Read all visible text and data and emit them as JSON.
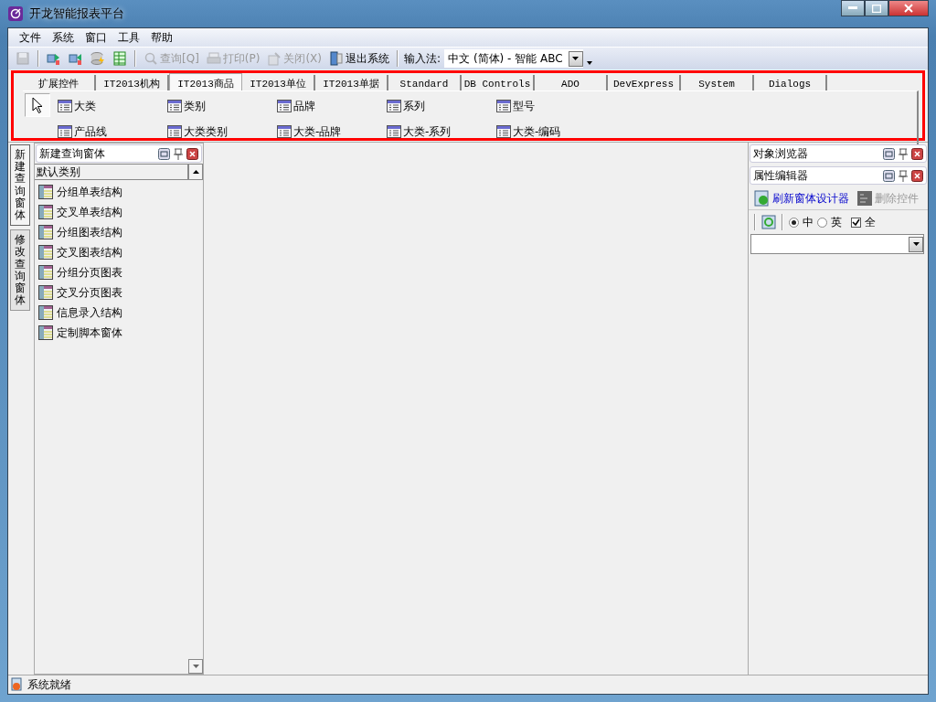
{
  "window": {
    "title": "开龙智能报表平台"
  },
  "menu": [
    "文件",
    "系统",
    "窗口",
    "工具",
    "帮助"
  ],
  "toolbar": [
    {
      "kind": "icon",
      "disabled": true
    },
    {
      "kind": "icon",
      "disabled": false
    },
    {
      "kind": "icon",
      "disabled": false
    },
    {
      "kind": "icon",
      "disabled": false
    },
    {
      "kind": "icon",
      "disabled": false
    },
    {
      "kind": "button",
      "label": "查询[Q]",
      "disabled": true
    },
    {
      "kind": "button",
      "label": "打印(P)",
      "disabled": true
    },
    {
      "kind": "button",
      "label": "关闭(X)",
      "disabled": true
    },
    {
      "kind": "button",
      "label": "退出系统",
      "disabled": false
    }
  ],
  "input_method": {
    "label": "输入法:",
    "value": "中文 (简体) - 智能 ABC"
  },
  "palette": {
    "tabs": [
      {
        "label": "扩展控件",
        "selected": false
      },
      {
        "label": "IT2013机构",
        "selected": false
      },
      {
        "label": "IT2013商品",
        "selected": true
      },
      {
        "label": "IT2013单位",
        "selected": false
      },
      {
        "label": "IT2013单据",
        "selected": false
      },
      {
        "label": "Standard",
        "selected": false
      },
      {
        "label": "DB Controls",
        "selected": false
      },
      {
        "label": "ADO",
        "selected": false
      },
      {
        "label": "DevExpress",
        "selected": false
      },
      {
        "label": "System",
        "selected": false
      },
      {
        "label": "Dialogs",
        "selected": false
      }
    ],
    "pointer_selected": true,
    "items": [
      "大类",
      "类别",
      "品牌",
      "系列",
      "型号",
      "产品线",
      "大类类别",
      "大类-品牌",
      "大类-系列",
      "大类-编码"
    ]
  },
  "side_tabs": [
    {
      "label": "新建查询窗体",
      "selected": true
    },
    {
      "label": "修改查询窗体",
      "selected": false
    }
  ],
  "left_panel": {
    "title": "新建查询窗体",
    "category": "默认类别",
    "items": [
      "分组单表结构",
      "交叉单表结构",
      "分组图表结构",
      "交叉图表结构",
      "分组分页图表",
      "交叉分页图表",
      "信息录入结构",
      "定制脚本窗体"
    ]
  },
  "object_browser": {
    "title": "对象浏览器"
  },
  "property_editor": {
    "title": "属性编辑器",
    "buttons": [
      {
        "label": "刷新窗体设计器",
        "disabled": false
      },
      {
        "label": "删除控件",
        "disabled": true
      }
    ],
    "radios": [
      {
        "label": "中",
        "selected": true
      },
      {
        "label": "英",
        "selected": false
      }
    ],
    "checkbox": {
      "label": "全",
      "checked": true
    }
  },
  "status_bar": {
    "text": "系统就绪"
  }
}
